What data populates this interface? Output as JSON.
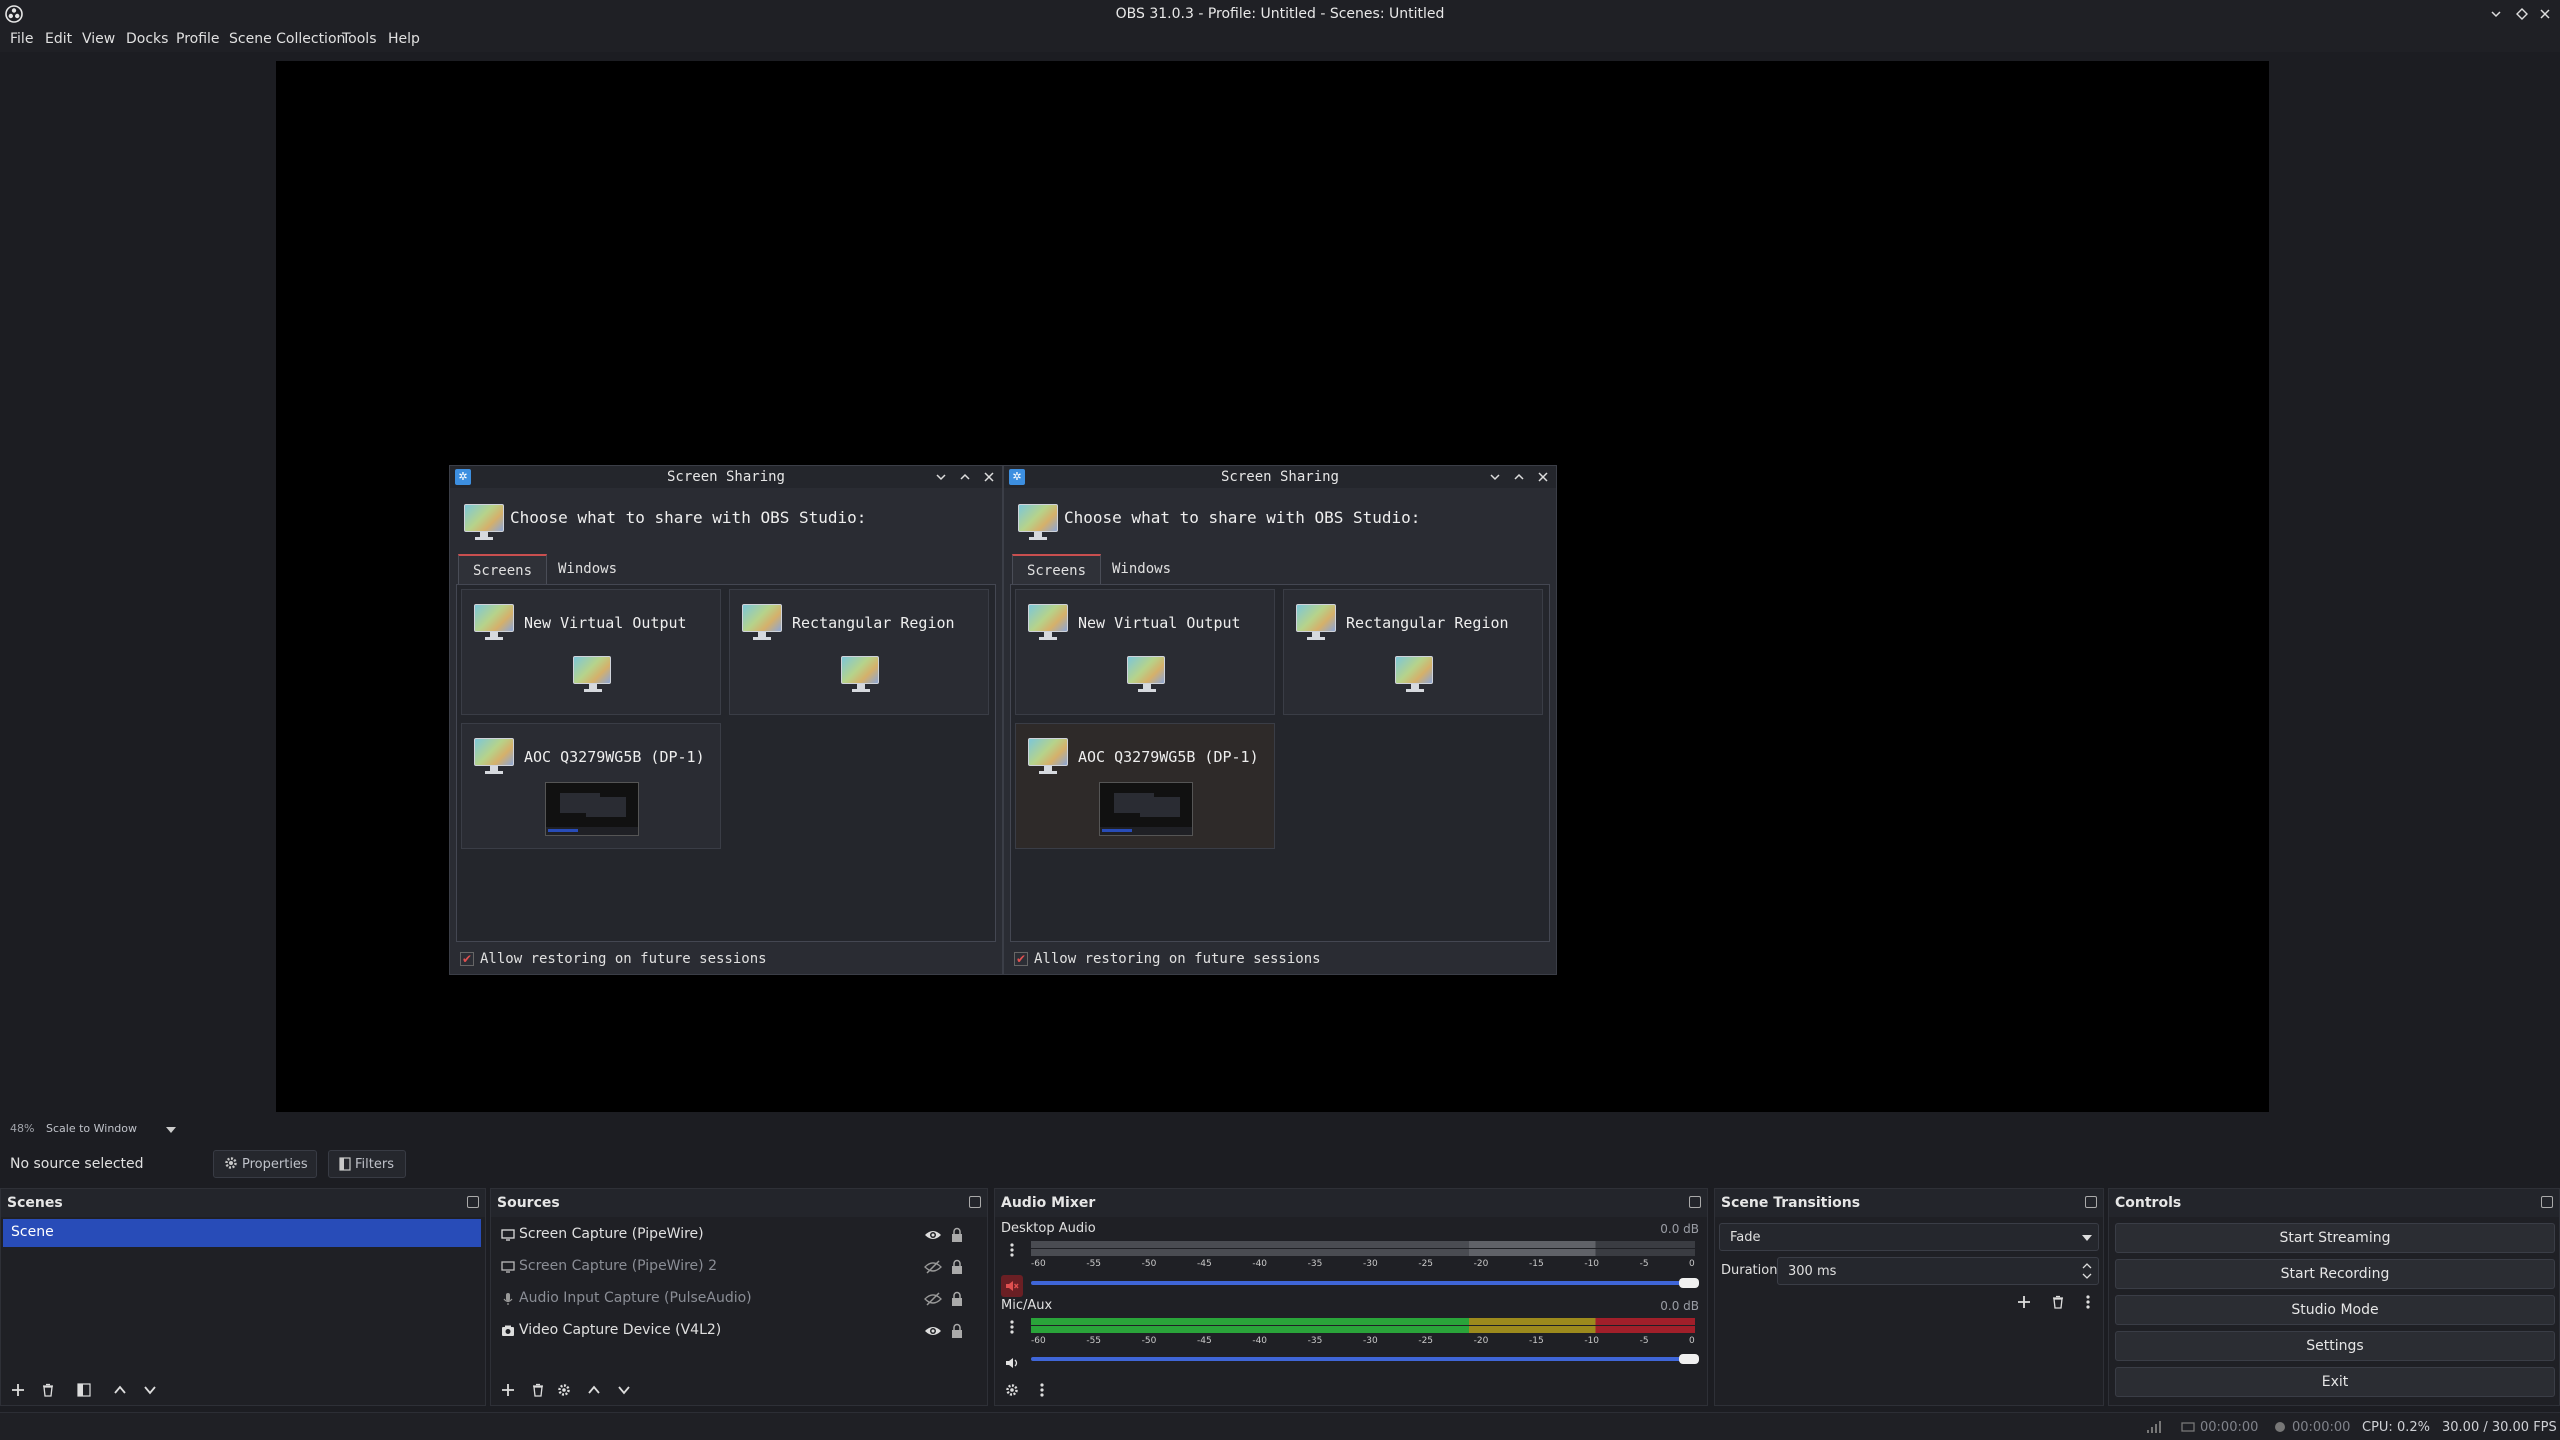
{
  "window": {
    "title": "OBS 31.0.3 - Profile: Untitled - Scenes: Untitled"
  },
  "menu": {
    "items": [
      "File",
      "Edit",
      "View",
      "Docks",
      "Profile",
      "Scene Collection",
      "Tools",
      "Help"
    ]
  },
  "dialogs": [
    {
      "title": "Screen Sharing",
      "heading": "Choose what to share with OBS Studio:",
      "tabs": [
        "Screens",
        "Windows"
      ],
      "active_tab": "Screens",
      "options": [
        "New Virtual Output",
        "Rectangular Region",
        "AOC Q3279WG5B (DP-1)"
      ],
      "checkbox_label": "Allow restoring on future sessions",
      "checkbox_checked": true
    },
    {
      "title": "Screen Sharing",
      "heading": "Choose what to share with OBS Studio:",
      "tabs": [
        "Screens",
        "Windows"
      ],
      "active_tab": "Screens",
      "options": [
        "New Virtual Output",
        "Rectangular Region",
        "AOC Q3279WG5B (DP-1)"
      ],
      "checkbox_label": "Allow restoring on future sessions",
      "checkbox_checked": true
    }
  ],
  "preview": {
    "zoom": "48%",
    "scale_mode": "Scale to Window"
  },
  "source_toolbar": {
    "status": "No source selected",
    "properties": "Properties",
    "filters": "Filters"
  },
  "scenes": {
    "title": "Scenes",
    "items": [
      "Scene"
    ]
  },
  "sources": {
    "title": "Sources",
    "items": [
      {
        "name": "Screen Capture (PipeWire)",
        "icon": "monitor-icon",
        "visible": true
      },
      {
        "name": "Screen Capture (PipeWire) 2",
        "icon": "monitor-icon",
        "visible": false
      },
      {
        "name": "Audio Input Capture (PulseAudio)",
        "icon": "microphone-icon",
        "visible": false
      },
      {
        "name": "Video Capture Device (V4L2)",
        "icon": "camera-icon",
        "visible": true
      }
    ]
  },
  "audio_mixer": {
    "title": "Audio Mixer",
    "ticks": [
      "-60",
      "-55",
      "-50",
      "-45",
      "-40",
      "-35",
      "-30",
      "-25",
      "-20",
      "-15",
      "-10",
      "-5",
      "0"
    ],
    "channels": [
      {
        "name": "Desktop Audio",
        "db": "0.0 dB",
        "muted": true,
        "level": 0.0,
        "volume": 1.0
      },
      {
        "name": "Mic/Aux",
        "db": "0.0 dB",
        "muted": false,
        "level": 1.0,
        "volume": 1.0
      }
    ]
  },
  "scene_transitions": {
    "title": "Scene Transitions",
    "transition": "Fade",
    "duration_label": "Duration",
    "duration": "300 ms"
  },
  "controls": {
    "title": "Controls",
    "buttons": [
      "Start Streaming",
      "Start Recording",
      "Studio Mode",
      "Settings",
      "Exit"
    ]
  },
  "status": {
    "stream_time": "00:00:00",
    "record_time": "00:00:00",
    "cpu": "CPU: 0.2%",
    "fps": "30.00 / 30.00 FPS"
  },
  "colors": {
    "accent": "#284cb8",
    "slider": "#3f66d8",
    "meter_green": "#2aa43a",
    "meter_yellow": "#9c8a1d",
    "meter_red": "#a11f2a",
    "tab_active": "#c94f4f"
  }
}
